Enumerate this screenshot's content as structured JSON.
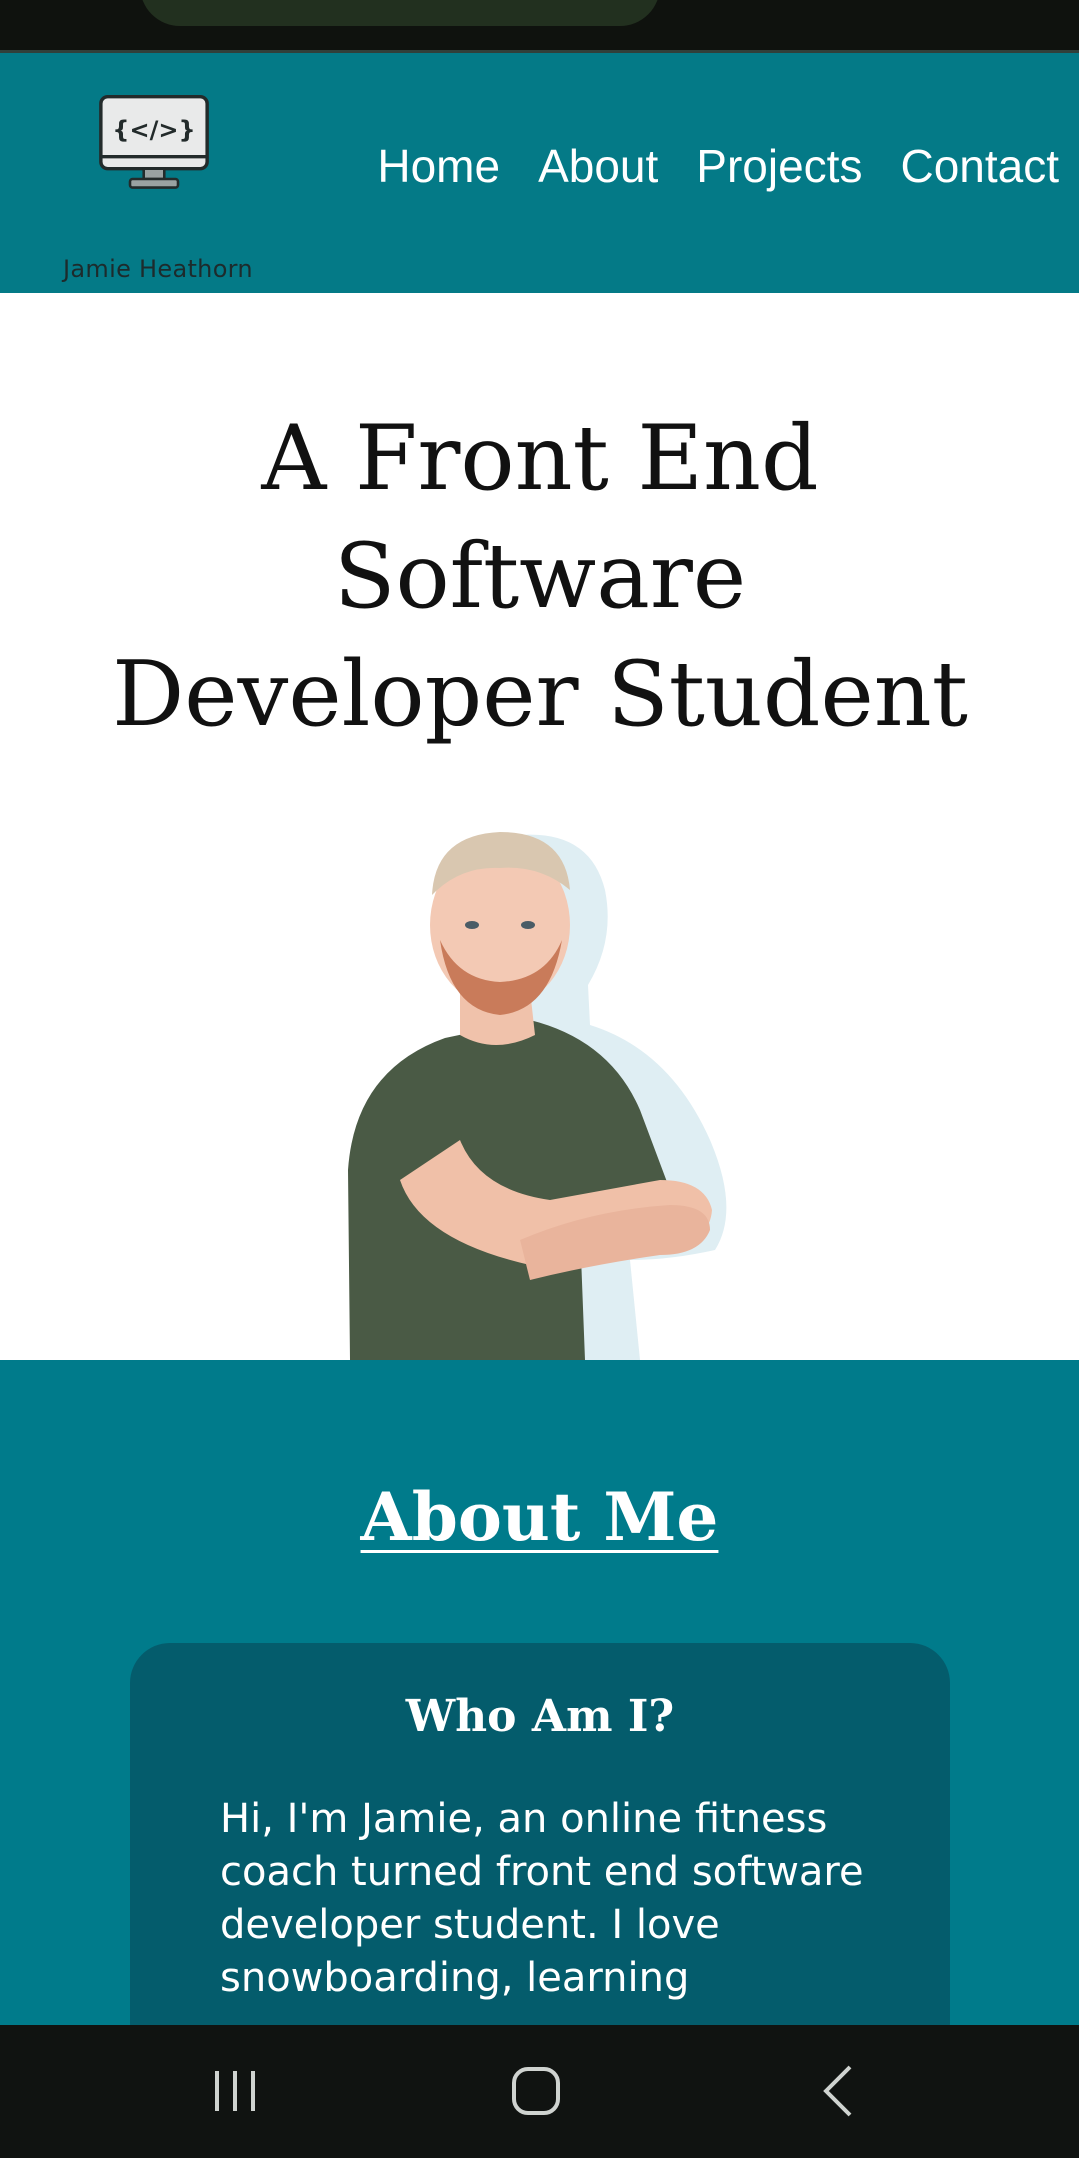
{
  "header": {
    "logo_text": "Jamie Heathorn",
    "logo_glyph": "{</>}",
    "nav": [
      {
        "label": "Home"
      },
      {
        "label": "About"
      },
      {
        "label": "Projects"
      },
      {
        "label": "Contact"
      }
    ],
    "background_color": "#047a87"
  },
  "hero": {
    "title_line1": "A Front End",
    "title_line2": "Software",
    "title_line3": "Developer Student",
    "photo_icon": "person-portrait-image"
  },
  "about": {
    "heading": "About Me",
    "card_title": "Who Am I?",
    "card_text": "Hi, I'm Jamie, an online fitness coach turned front end software developer student. I love snowboarding, learning",
    "section_color": "#007b8b",
    "card_color": "#045c6c"
  },
  "system_nav": {
    "icons": [
      "recent-apps-icon",
      "home-icon",
      "back-icon"
    ]
  }
}
